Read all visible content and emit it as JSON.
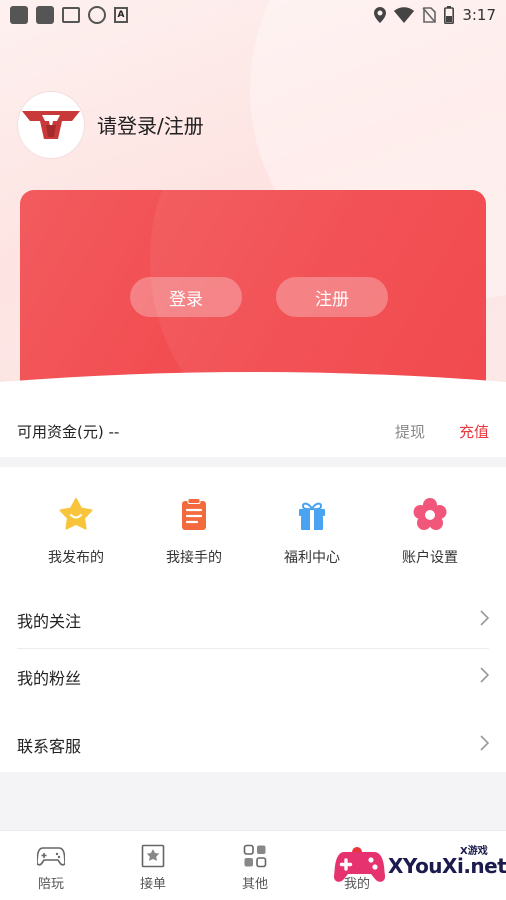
{
  "status_bar": {
    "time": "3:17"
  },
  "profile": {
    "title": "请登录/注册"
  },
  "card": {
    "login_label": "登录",
    "register_label": "注册"
  },
  "funds": {
    "label": "可用资金(元) --",
    "withdraw": "提现",
    "recharge": "充值"
  },
  "grid": [
    {
      "label": "我发布的",
      "icon": "star-icon"
    },
    {
      "label": "我接手的",
      "icon": "clipboard-icon"
    },
    {
      "label": "福利中心",
      "icon": "gift-icon"
    },
    {
      "label": "账户设置",
      "icon": "flower-gear-icon"
    }
  ],
  "list": [
    {
      "label": "我的关注"
    },
    {
      "label": "我的粉丝"
    },
    {
      "label": "联系客服"
    }
  ],
  "nav": [
    {
      "label": "陪玩",
      "icon": "gamepad-icon"
    },
    {
      "label": "接单",
      "icon": "bookmark-icon"
    },
    {
      "label": "其他",
      "icon": "grid-icon"
    },
    {
      "label": "我的",
      "icon": "profile-icon"
    }
  ],
  "watermark": {
    "brand": "XYouXi.net",
    "small": "X游戏"
  },
  "colors": {
    "accent": "#e8383d",
    "card": "#f2484c"
  }
}
